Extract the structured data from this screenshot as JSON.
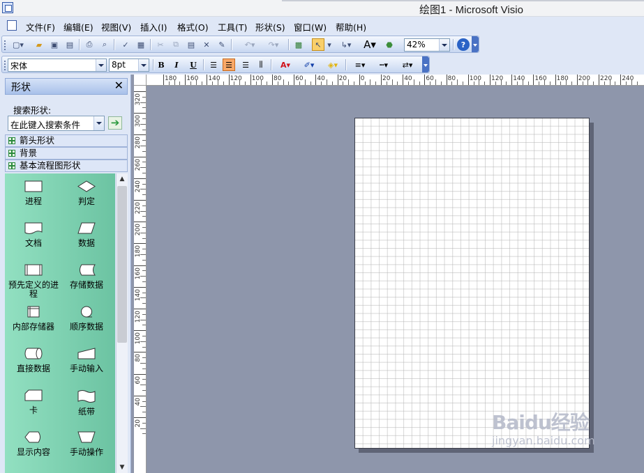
{
  "window": {
    "title": "绘图1 - Microsoft Visio"
  },
  "menu": [
    "文件(F)",
    "编辑(E)",
    "视图(V)",
    "插入(I)",
    "格式(O)",
    "工具(T)",
    "形状(S)",
    "窗口(W)",
    "帮助(H)"
  ],
  "toolbar": {
    "zoom": "42%",
    "font_name": "宋体",
    "font_size": "8pt",
    "bold": "B",
    "italic": "I",
    "underline": "U",
    "text_tool": "A"
  },
  "shapes_panel": {
    "title": "形状",
    "close": "✕",
    "search_label": "搜索形状:",
    "search_placeholder": "在此键入搜索条件",
    "stencils": [
      "箭头形状",
      "背景",
      "基本流程图形状"
    ],
    "shapes": [
      "进程",
      "判定",
      "文档",
      "数据",
      "预先定义的进程",
      "存储数据",
      "内部存储器",
      "顺序数据",
      "直接数据",
      "手动输入",
      "卡",
      "纸带",
      "显示内容",
      "手动操作"
    ]
  },
  "hruler_labels": [
    "180",
    "160",
    "140",
    "120",
    "100",
    "80",
    "60",
    "40",
    "20",
    "0",
    "20",
    "40",
    "60",
    "80",
    "100",
    "120",
    "140",
    "160",
    "180",
    "200",
    "220",
    "240"
  ],
  "vruler_labels": [
    "320",
    "300",
    "280",
    "260",
    "240",
    "220",
    "200",
    "180",
    "160",
    "140",
    "120",
    "100",
    "80",
    "60",
    "40",
    "20"
  ],
  "watermark": {
    "logo": "Baidu经验",
    "url": "jingyan.baidu.com"
  }
}
